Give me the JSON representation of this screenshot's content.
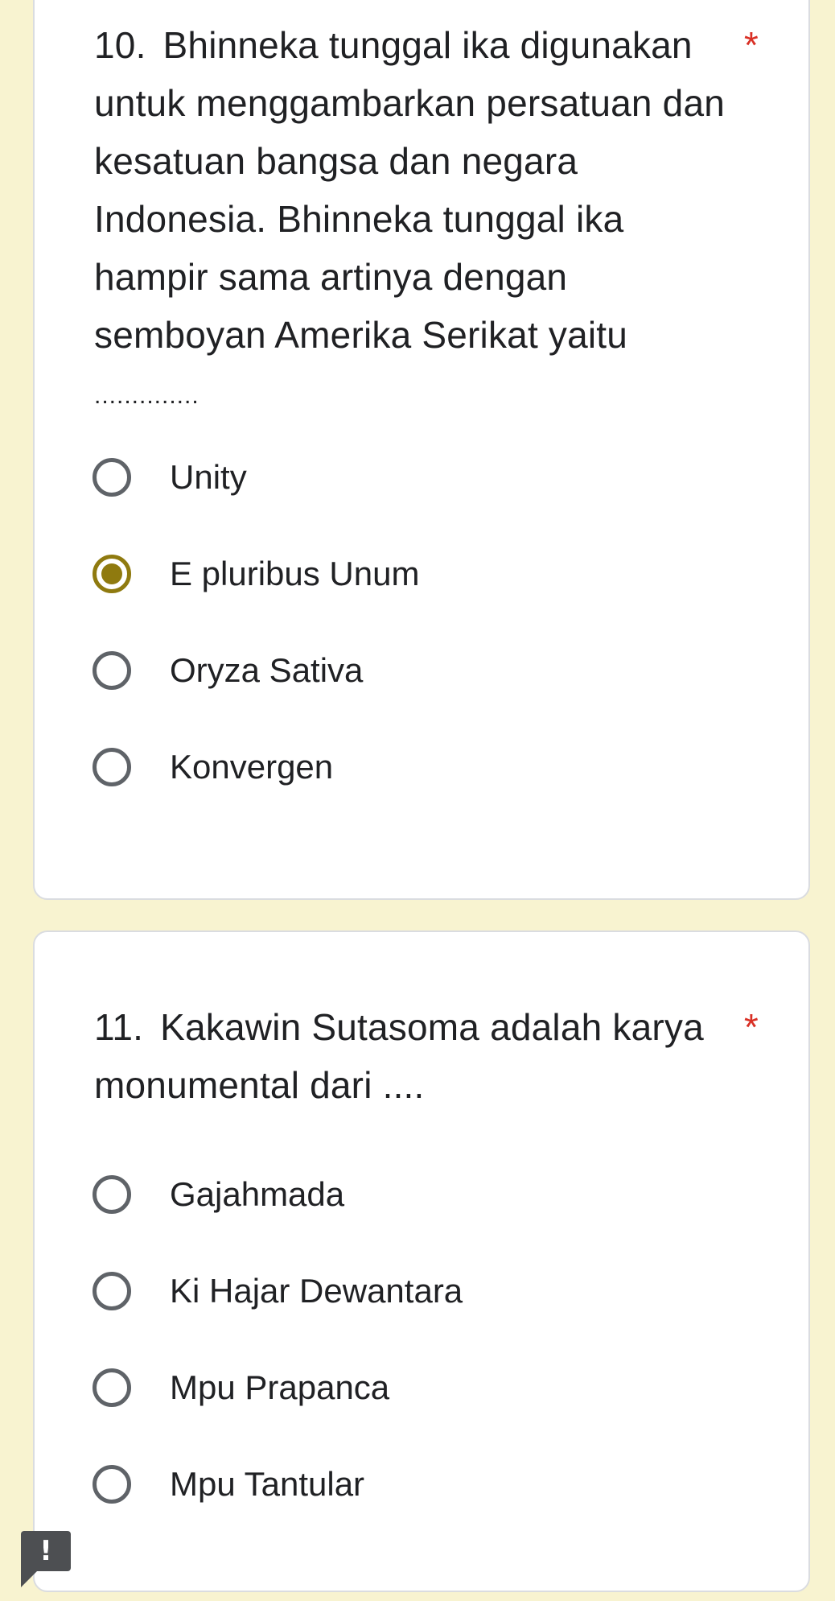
{
  "questions": [
    {
      "number": "10.",
      "text": "Bhinneka tunggal ika digunakan untuk menggambarkan persatuan dan kesatuan bangsa dan negara Indonesia. Bhinneka tunggal ika hampir sama artinya dengan semboyan Amerika Serikat yaitu",
      "blank": "..............",
      "required_mark": "*",
      "options": [
        "Unity",
        "E pluribus Unum",
        "Oryza Sativa",
        "Konvergen"
      ],
      "selected": "E pluribus Unum"
    },
    {
      "number": "11.",
      "text": "Kakawin Sutasoma adalah karya monumental dari ....",
      "required_mark": "*",
      "options": [
        "Gajahmada",
        "Ki Hajar Dewantara",
        "Mpu Prapanca",
        "Mpu Tantular"
      ],
      "selected": null
    }
  ],
  "report_button": {
    "label": "!",
    "icon": "exclamation-icon"
  },
  "colors": {
    "page_background": "#f8f3d0",
    "card_background": "#ffffff",
    "radio_selected": "#8f7a0f",
    "radio_unselected": "#5f6368",
    "required": "#d93025"
  }
}
